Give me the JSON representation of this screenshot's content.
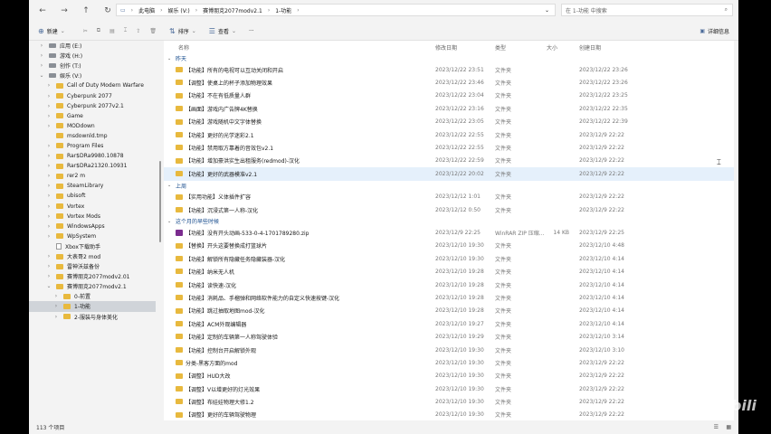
{
  "breadcrumb": [
    "此电脑",
    "娱乐 (V:)",
    "赛博朋克2077modv2.1",
    "1-功能"
  ],
  "search_placeholder": "在 1-功能 中搜索",
  "toolbar": {
    "new_label": "新建",
    "sort_label": "排序",
    "view_label": "查看",
    "more_label": "···",
    "details_label": "详细信息"
  },
  "sidebar": [
    {
      "label": "应用 (E:)",
      "icon": "drive",
      "indent": 0,
      "chev": "›"
    },
    {
      "label": "游戏 (H:)",
      "icon": "drive",
      "indent": 0,
      "chev": "›"
    },
    {
      "label": "创作 (T:)",
      "icon": "drive",
      "indent": 0,
      "chev": "›"
    },
    {
      "label": "娱乐 (V:)",
      "icon": "drive",
      "indent": 0,
      "chev": "⌄"
    },
    {
      "label": "Call of Duty Modern Warfare",
      "icon": "folder",
      "indent": 1,
      "chev": "›"
    },
    {
      "label": "Cyberpunk 2077",
      "icon": "folder",
      "indent": 1,
      "chev": "›"
    },
    {
      "label": "Cyberpunk 2077v2.1",
      "icon": "folder",
      "indent": 1,
      "chev": "›"
    },
    {
      "label": "Game",
      "icon": "folder",
      "indent": 1,
      "chev": "›"
    },
    {
      "label": "MODdown",
      "icon": "folder",
      "indent": 1,
      "chev": "›"
    },
    {
      "label": "msdownld.tmp",
      "icon": "folder",
      "indent": 1,
      "chev": ""
    },
    {
      "label": "Program Files",
      "icon": "folder",
      "indent": 1,
      "chev": "›"
    },
    {
      "label": "Rar$DRa9980.10878",
      "icon": "folder",
      "indent": 1,
      "chev": "›"
    },
    {
      "label": "Rar$DRa21320.10931",
      "icon": "folder",
      "indent": 1,
      "chev": "›"
    },
    {
      "label": "rer2 m",
      "icon": "folder",
      "indent": 1,
      "chev": "›"
    },
    {
      "label": "SteamLibrary",
      "icon": "folder",
      "indent": 1,
      "chev": "›"
    },
    {
      "label": "ubisoft",
      "icon": "folder",
      "indent": 1,
      "chev": "›"
    },
    {
      "label": "Vortex",
      "icon": "folder",
      "indent": 1,
      "chev": "›"
    },
    {
      "label": "Vortex Mods",
      "icon": "folder",
      "indent": 1,
      "chev": "›"
    },
    {
      "label": "WindowsApps",
      "icon": "folder",
      "indent": 1,
      "chev": "›"
    },
    {
      "label": "WpSystem",
      "icon": "folder",
      "indent": 1,
      "chev": "›"
    },
    {
      "label": "Xbox下载助手",
      "icon": "file",
      "indent": 1,
      "chev": ""
    },
    {
      "label": "大表哥2 mod",
      "icon": "folder",
      "indent": 1,
      "chev": "›"
    },
    {
      "label": "雷神沃兹备份",
      "icon": "folder",
      "indent": 1,
      "chev": "›"
    },
    {
      "label": "赛博朋克2077modv2.01",
      "icon": "folder",
      "indent": 1,
      "chev": "›"
    },
    {
      "label": "赛博朋克2077modv2.1",
      "icon": "folder",
      "indent": 1,
      "chev": "⌄"
    },
    {
      "label": "0-前置",
      "icon": "folder",
      "indent": 2,
      "chev": "›"
    },
    {
      "label": "1-功能",
      "icon": "folder",
      "indent": 2,
      "chev": "›",
      "selected": true
    },
    {
      "label": "2-服装与身体美化",
      "icon": "folder",
      "indent": 2,
      "chev": "›"
    }
  ],
  "columns": {
    "name": "名称",
    "modified": "修改日期",
    "type": "类型",
    "size": "大小",
    "created": "创建日期"
  },
  "groups": [
    {
      "label": "昨天",
      "rows": [
        {
          "name": "【功能】所有的电视可以互动关闭和开启",
          "modified": "2023/12/22 23:51",
          "type": "文件夹",
          "size": "",
          "created": "2023/12/22 23:26"
        },
        {
          "name": "【调整】使桌上的杯子添加物理效果",
          "modified": "2023/12/22 23:46",
          "type": "文件夹",
          "size": "",
          "created": "2023/12/22 23:26"
        },
        {
          "name": "【功能】不在有低质量人群",
          "modified": "2023/12/22 23:04",
          "type": "文件夹",
          "size": "",
          "created": "2023/12/22 23:25"
        },
        {
          "name": "【画面】游戏内广告牌4K替换",
          "modified": "2023/12/22 23:16",
          "type": "文件夹",
          "size": "",
          "created": "2023/12/22 22:35"
        },
        {
          "name": "【功能】游戏随机中文字体替换",
          "modified": "2023/12/22 23:05",
          "type": "文件夹",
          "size": "",
          "created": "2023/12/22 22:39"
        },
        {
          "name": "【功能】更好的光学迷彩2.1",
          "modified": "2023/12/22 22:55",
          "type": "文件夹",
          "size": "",
          "created": "2023/12/9 22:22"
        },
        {
          "name": "【功能】禁用取方靠着的音效包v2.1",
          "modified": "2023/12/22 22:55",
          "type": "文件夹",
          "size": "",
          "created": "2023/12/9 22:22"
        },
        {
          "name": "【功能】增加豪洪实生出租服务(redmod)-汉化",
          "modified": "2023/12/22 22:59",
          "type": "文件夹",
          "size": "",
          "created": "2023/12/9 22:22"
        },
        {
          "name": "【功能】更好的武器模准v2.1",
          "modified": "2023/12/22 20:02",
          "type": "文件夹",
          "size": "",
          "created": "2023/12/9 22:22",
          "selected": true
        }
      ]
    },
    {
      "label": "上周",
      "rows": [
        {
          "name": "【实用功能】义体插件扩容",
          "modified": "2023/12/12 1:01",
          "type": "文件夹",
          "size": "",
          "created": "2023/12/9 22:22"
        },
        {
          "name": "【功能】沉浸式第一人称-汉化",
          "modified": "2023/12/12 0:50",
          "type": "文件夹",
          "size": "",
          "created": "2023/12/9 22:22"
        }
      ]
    },
    {
      "label": "这个月的早些时候",
      "rows": [
        {
          "name": "【功能】没有开头动画-533-0-4-1701789280.zip",
          "modified": "2023/12/9 22:25",
          "type": "WinRAR ZIP 压缩...",
          "size": "14 KB",
          "created": "2023/12/9 22:25",
          "zip": true
        },
        {
          "name": "【替换】开头这要替换成打篮球片",
          "modified": "2023/12/10 19:30",
          "type": "文件夹",
          "size": "",
          "created": "2023/12/10 4:48"
        },
        {
          "name": "【功能】解锁所有隐藏任务隐藏装器-汉化",
          "modified": "2023/12/10 19:30",
          "type": "文件夹",
          "size": "",
          "created": "2023/12/10 4:14"
        },
        {
          "name": "【功能】纳米无人机",
          "modified": "2023/12/10 19:28",
          "type": "文件夹",
          "size": "",
          "created": "2023/12/10 4:14"
        },
        {
          "name": "【功能】读快速-汉化",
          "modified": "2023/12/10 19:28",
          "type": "文件夹",
          "size": "",
          "created": "2023/12/10 4:14"
        },
        {
          "name": "【功能】消耗品、手榴弹和网络软件能力的自定义快速按键-汉化",
          "modified": "2023/12/10 19:28",
          "type": "文件夹",
          "size": "",
          "created": "2023/12/10 4:14"
        },
        {
          "name": "【功能】跳过抽取地图mod-汉化",
          "modified": "2023/12/10 19:28",
          "type": "文件夹",
          "size": "",
          "created": "2023/12/10 4:14"
        },
        {
          "name": "【功能】ACM外观编辑器",
          "modified": "2023/12/10 19:27",
          "type": "文件夹",
          "size": "",
          "created": "2023/12/10 4:14"
        },
        {
          "name": "【功能】定制的车辆第一人称驾驶体验",
          "modified": "2023/12/10 19:29",
          "type": "文件夹",
          "size": "",
          "created": "2023/12/10 3:14"
        },
        {
          "name": "【功能】控制台开启解锁外观",
          "modified": "2023/12/10 19:30",
          "type": "文件夹",
          "size": "",
          "created": "2023/12/10 3:10"
        },
        {
          "name": "分类-黑客方面的mod",
          "modified": "2023/12/10 19:30",
          "type": "文件夹",
          "size": "",
          "created": "2023/12/9 22:22"
        },
        {
          "name": "【调整】HUD大改",
          "modified": "2023/12/10 19:30",
          "type": "文件夹",
          "size": "",
          "created": "2023/12/9 22:22"
        },
        {
          "name": "【调整】V以增更好的灯光效果",
          "modified": "2023/12/10 19:30",
          "type": "文件夹",
          "size": "",
          "created": "2023/12/9 22:22"
        },
        {
          "name": "【调整】布娃娃物理大修1.2",
          "modified": "2023/12/10 19:30",
          "type": "文件夹",
          "size": "",
          "created": "2023/12/9 22:22"
        },
        {
          "name": "【调整】更好的车辆驾驶物理",
          "modified": "2023/12/10 19:30",
          "type": "文件夹",
          "size": "",
          "created": "2023/12/9 22:22"
        }
      ]
    }
  ],
  "status": {
    "count_label": "113 个项目"
  },
  "watermark": "bilibili"
}
